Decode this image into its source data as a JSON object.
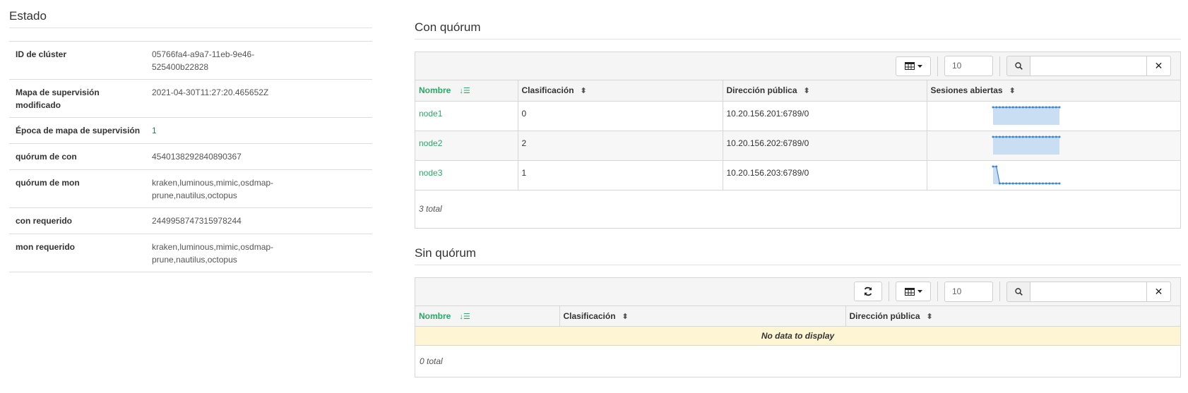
{
  "status": {
    "title": "Estado",
    "rows": [
      {
        "key": "ID de clúster",
        "value": "05766fa4-a9a7-11eb-9e46-525400b22828"
      },
      {
        "key": "Mapa de supervisión modificado",
        "value": "2021-04-30T11:27:20.465652Z"
      },
      {
        "key": "Época de mapa de supervisión",
        "value": "1"
      },
      {
        "key": "quórum de con",
        "value": "4540138292840890367"
      },
      {
        "key": "quórum de mon",
        "value": "kraken,luminous,mimic,osdmap-prune,nautilus,octopus"
      },
      {
        "key": "con requerido",
        "value": "2449958747315978244"
      },
      {
        "key": "mon requerido",
        "value": "kraken,luminous,mimic,osdmap-prune,nautilus,octopus"
      }
    ]
  },
  "in_quorum": {
    "title": "Con quórum",
    "page_size": "10",
    "columns": [
      "Nombre",
      "Clasificación",
      "Dirección pública",
      "Sesiones abiertas"
    ],
    "rows": [
      {
        "name": "node1",
        "rank": "0",
        "address": "10.20.156.201:6789/0",
        "sessions": [
          1,
          1,
          1,
          1,
          1,
          1,
          1,
          1,
          1,
          1,
          1,
          1,
          1,
          1,
          1,
          1,
          1,
          1,
          1,
          1,
          1
        ]
      },
      {
        "name": "node2",
        "rank": "2",
        "address": "10.20.156.202:6789/0",
        "sessions": [
          1,
          1,
          1,
          1,
          1,
          1,
          1,
          1,
          1,
          1,
          1,
          1,
          1,
          1,
          1,
          1,
          1,
          1,
          1,
          1,
          1
        ]
      },
      {
        "name": "node3",
        "rank": "1",
        "address": "10.20.156.203:6789/0",
        "sessions": [
          8,
          8,
          0,
          0,
          0,
          0,
          0,
          0,
          0,
          0,
          0,
          0,
          0,
          0,
          0,
          0,
          0,
          0,
          0,
          0,
          0
        ]
      }
    ],
    "total": "3 total"
  },
  "out_quorum": {
    "title": "Sin quórum",
    "page_size": "10",
    "columns": [
      "Nombre",
      "Clasificación",
      "Dirección pública"
    ],
    "empty_message": "No data to display",
    "total": "0 total"
  },
  "icons": {
    "columns": "table-columns-icon",
    "search": "search-icon",
    "clear": "close-icon",
    "refresh": "refresh-icon",
    "sort": "sort-icon",
    "sort_active": "sort-asc-icon"
  },
  "colors": {
    "accent": "#2aa868",
    "sparkline_line": "#3a86d6",
    "sparkline_fill": "#c9def3",
    "empty_bg": "#fdf5d3"
  }
}
